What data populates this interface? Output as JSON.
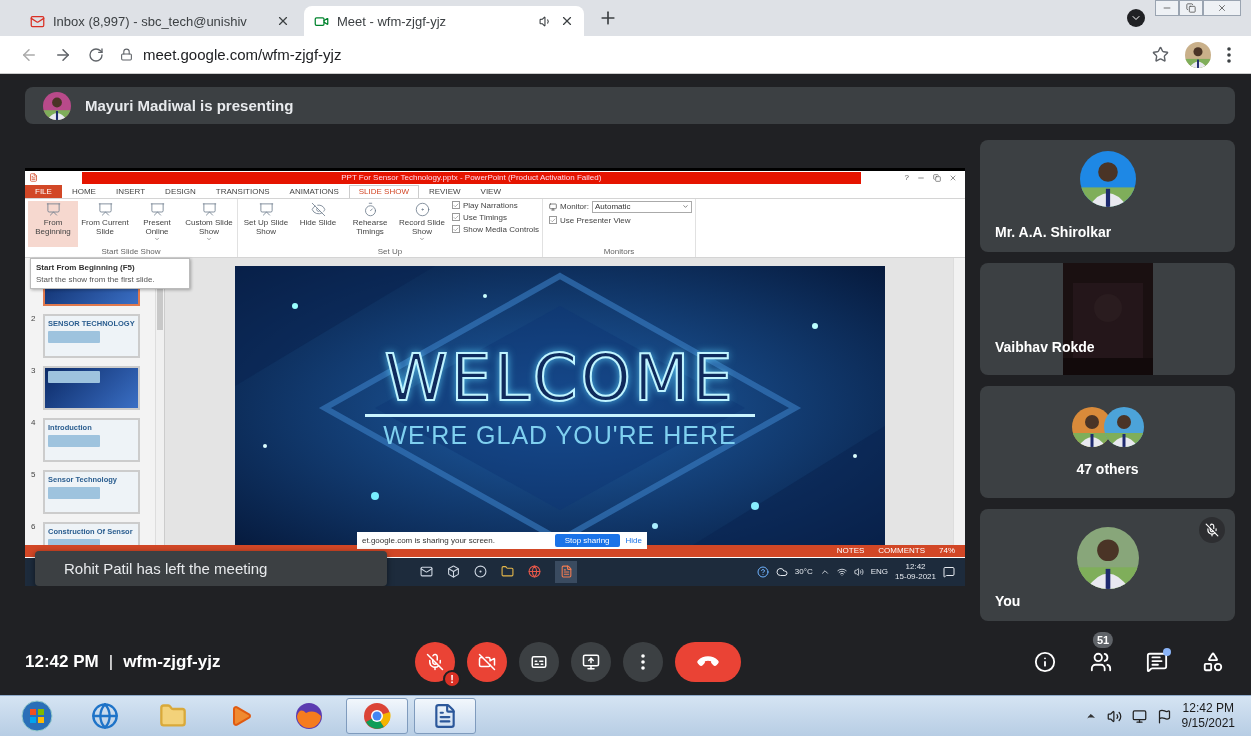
{
  "browser": {
    "tabs": [
      {
        "kind": "mail",
        "title": "Inbox (8,997) - sbc_tech@unishiv",
        "selected": false,
        "audio": false
      },
      {
        "kind": "meet",
        "title": "Meet - wfm-zjgf-yjz",
        "selected": true,
        "audio": true
      }
    ],
    "url": "meet.google.com/wfm-zjgf-yjz"
  },
  "banner": {
    "text": "Mayuri Madiwal is presenting"
  },
  "shared_screen": {
    "powerpoint": {
      "title": "PPT For Sensor Technology.pptx - PowerPoint (Product Activation Failed)",
      "help": "?",
      "menu_tabs": [
        {
          "label": "FILE",
          "kind": "file",
          "selected": false
        },
        {
          "label": "HOME",
          "kind": "tab",
          "selected": false
        },
        {
          "label": "INSERT",
          "kind": "tab",
          "selected": false
        },
        {
          "label": "DESIGN",
          "kind": "tab",
          "selected": false
        },
        {
          "label": "TRANSITIONS",
          "kind": "tab",
          "selected": false
        },
        {
          "label": "ANIMATIONS",
          "kind": "tab",
          "selected": false
        },
        {
          "label": "SLIDE SHOW",
          "kind": "tab",
          "selected": true
        },
        {
          "label": "REVIEW",
          "kind": "tab",
          "selected": false
        },
        {
          "label": "VIEW",
          "kind": "tab",
          "selected": false
        }
      ],
      "ribbon_groups": [
        {
          "label": "Start Slide Show",
          "items": [
            {
              "kind": "button",
              "label": "From Beginning",
              "selected": true,
              "dropdown": false
            },
            {
              "kind": "button",
              "label": "From Current Slide",
              "selected": false,
              "dropdown": false
            },
            {
              "kind": "button",
              "label": "Present Online",
              "selected": false,
              "dropdown": true
            },
            {
              "kind": "button",
              "label": "Custom Slide Show",
              "selected": false,
              "dropdown": true
            }
          ]
        },
        {
          "label": "Set Up",
          "items": [
            {
              "kind": "button",
              "label": "Set Up Slide Show",
              "selected": false,
              "dropdown": false
            },
            {
              "kind": "button",
              "label": "Hide Slide",
              "selected": false,
              "dropdown": false
            },
            {
              "kind": "button",
              "label": "Rehearse Timings",
              "selected": false,
              "dropdown": false
            },
            {
              "kind": "button",
              "label": "Record Slide Show",
              "selected": false,
              "dropdown": true
            },
            {
              "kind": "checkbox",
              "label": "Play Narrations",
              "checked": true
            },
            {
              "kind": "checkbox",
              "label": "Use Timings",
              "checked": true
            },
            {
              "kind": "checkbox",
              "label": "Show Media Controls",
              "checked": true
            }
          ]
        },
        {
          "label": "Monitors",
          "items": [
            {
              "kind": "select",
              "label": "Monitor:",
              "value": "Automatic"
            },
            {
              "kind": "checkbox",
              "label": "Use Presenter View",
              "checked": true
            }
          ]
        }
      ],
      "tooltip": {
        "title": "Start From Beginning (F5)",
        "text": "Start the show from the first slide."
      },
      "thumbnails": [
        {
          "kind": "dark",
          "selected": true
        },
        {
          "number": "2",
          "title": "SENSOR TECHNOLOGY",
          "kind": "light",
          "selected": false
        },
        {
          "number": "3",
          "kind": "dark",
          "selected": false
        },
        {
          "number": "4",
          "title": "Introduction",
          "kind": "light",
          "selected": false
        },
        {
          "number": "5",
          "title": "Sensor Technology",
          "kind": "light",
          "selected": false
        },
        {
          "number": "6",
          "title": "Construction Of Sensor",
          "kind": "light",
          "selected": false
        }
      ],
      "slide": {
        "heading": "WELCOME",
        "subheading": "WE'RE GLAD YOU'RE HERE"
      },
      "status_bar": {
        "notes": "NOTES",
        "comments": "COMMENTS",
        "zoom": "74%"
      }
    },
    "taskbar": {
      "weather": "30°C",
      "language": "ENG",
      "time": "12:42",
      "date": "15-09-2021"
    },
    "sharing_bar": {
      "text": "et.google.com is sharing your screen.",
      "stop": "Stop sharing",
      "hide": "Hide"
    },
    "toast": "Rohit Patil has left the meeting"
  },
  "participants": [
    {
      "kind": "person",
      "name": "Mr. A.A. Shirolkar",
      "muted": false
    },
    {
      "kind": "video",
      "name": "Vaibhav Rokde",
      "muted": false
    },
    {
      "kind": "group",
      "name": "47 others",
      "muted": false
    },
    {
      "kind": "person",
      "name": "You",
      "muted": true
    }
  ],
  "meeting": {
    "time": "12:42 PM",
    "separator": "|",
    "code": "wfm-zjgf-yjz"
  },
  "call_controls": [
    {
      "kind": "mic",
      "on": false,
      "badge": "!"
    },
    {
      "kind": "camera",
      "on": false
    },
    {
      "kind": "captions",
      "on": false
    },
    {
      "kind": "present",
      "on": false
    },
    {
      "kind": "more"
    },
    {
      "kind": "leave"
    }
  ],
  "side_controls": [
    {
      "kind": "info"
    },
    {
      "kind": "people",
      "badge": "51"
    },
    {
      "kind": "chat",
      "unread": true
    },
    {
      "kind": "activities"
    }
  ],
  "taskbar": {
    "apps": [
      {
        "kind": "start",
        "open": false
      },
      {
        "kind": "ie",
        "open": false
      },
      {
        "kind": "explorer",
        "open": false
      },
      {
        "kind": "media",
        "open": false
      },
      {
        "kind": "firefox",
        "open": false
      },
      {
        "kind": "chrome",
        "open": true
      },
      {
        "kind": "word",
        "open": true
      }
    ],
    "time": "12:42 PM",
    "date": "9/15/2021"
  }
}
